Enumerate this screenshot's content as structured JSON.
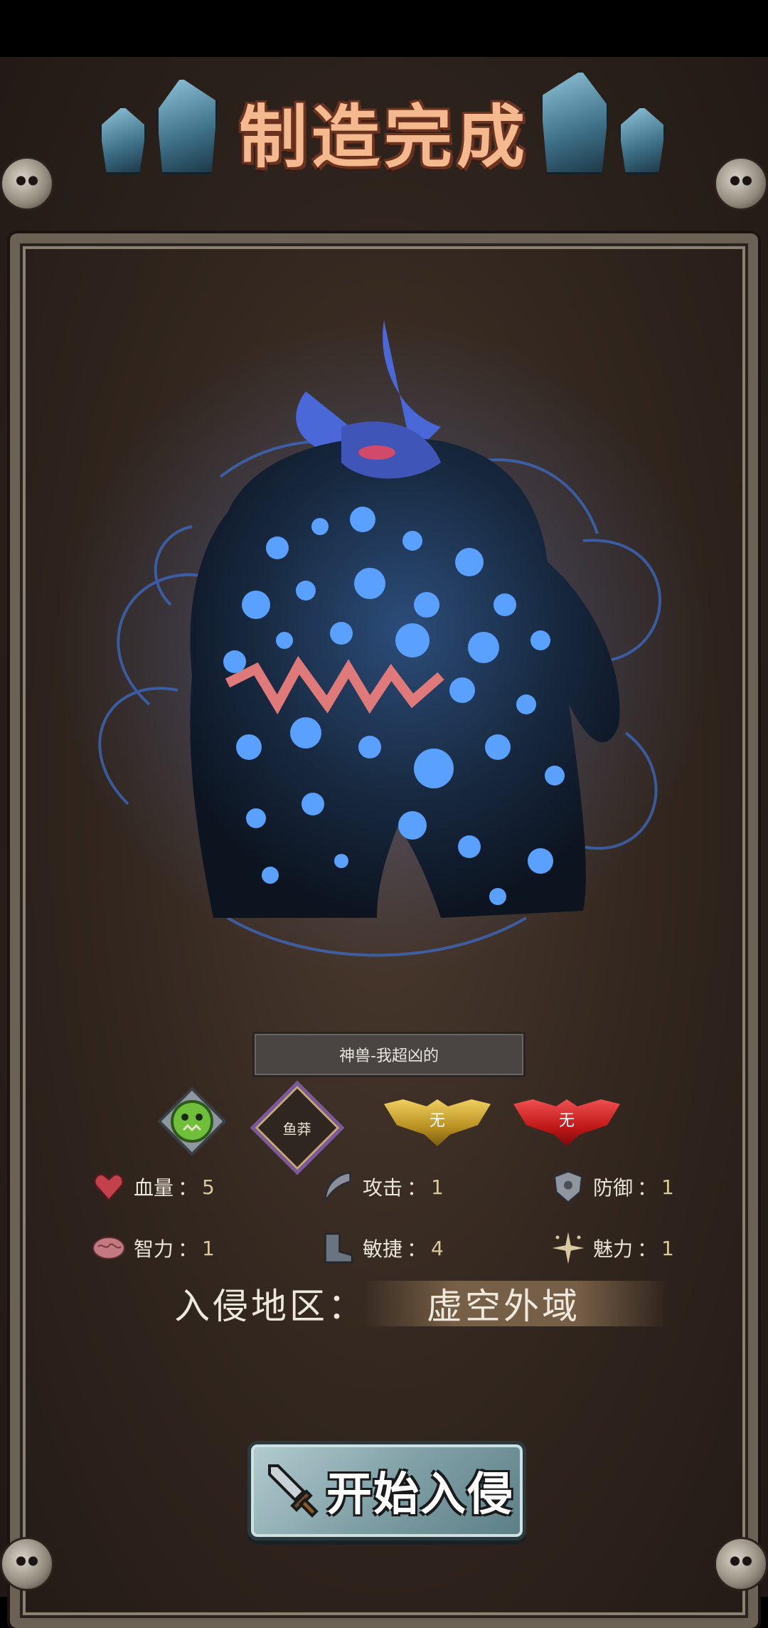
{
  "title": "制造完成",
  "monster": {
    "name": "神兽-我超凶的"
  },
  "badges": {
    "race_icon": "orc-face-icon",
    "trait_label": "鱼莽",
    "gold_wing_label": "无",
    "red_wing_label": "无"
  },
  "stats": [
    {
      "label": "血量",
      "value": "5",
      "icon": "heart-icon",
      "color": "#c2414a"
    },
    {
      "label": "攻击",
      "value": "1",
      "icon": "claw-icon",
      "color": "#8a8f9a"
    },
    {
      "label": "防御",
      "value": "1",
      "icon": "shield-icon",
      "color": "#8f96a0"
    },
    {
      "label": "智力",
      "value": "1",
      "icon": "brain-icon",
      "color": "#c27a80"
    },
    {
      "label": "敏捷",
      "value": "4",
      "icon": "boot-icon",
      "color": "#6a7480"
    },
    {
      "label": "魅力",
      "value": "1",
      "icon": "sparkle-icon",
      "color": "#d8c9a0"
    }
  ],
  "stat_colon": "：",
  "region": {
    "label": "入侵地区：",
    "value": "虚空外域"
  },
  "start_button": {
    "label": "开始入侵",
    "icon": "sword-icon"
  },
  "colors": {
    "accent_title": "#f4b98e",
    "stat_value": "#d9c89a",
    "monster_glow": "#3d7bff"
  }
}
